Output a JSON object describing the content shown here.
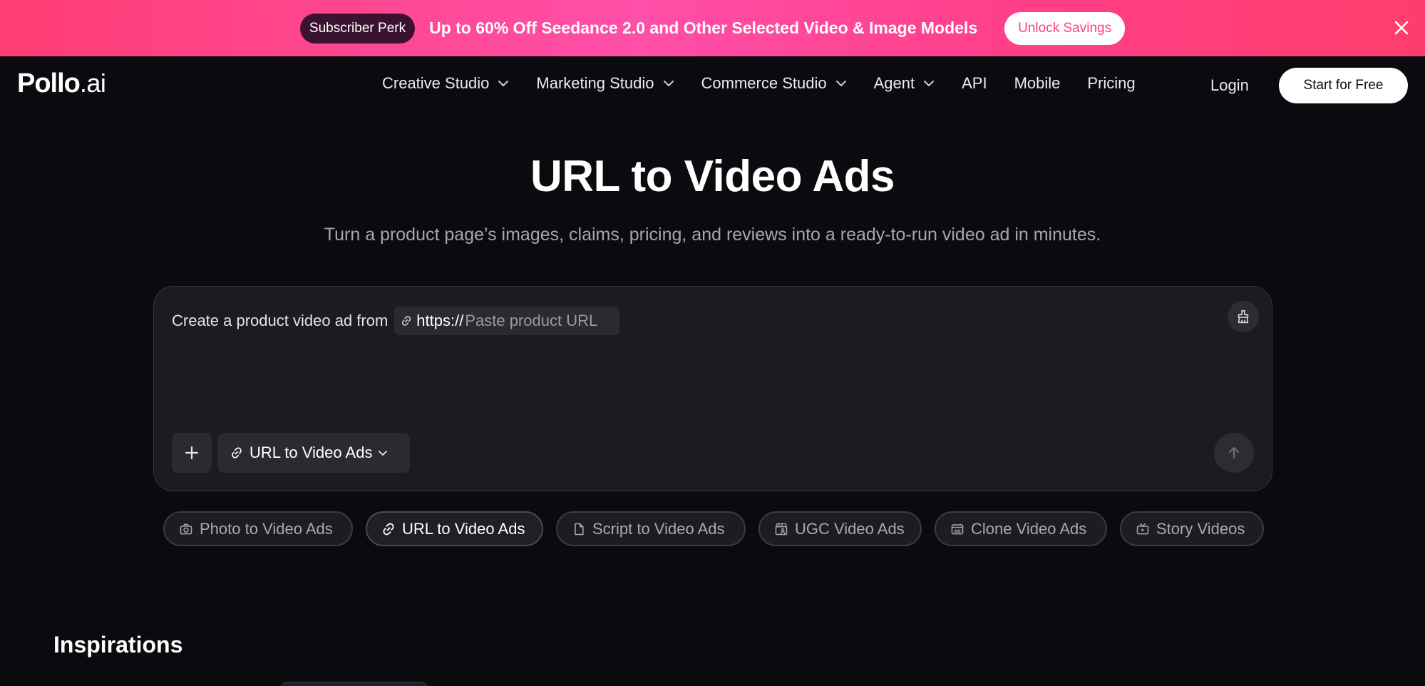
{
  "promo": {
    "badge": "Subscriber Perk",
    "text": "Up to 60% Off Seedance 2.0 and Other Selected Video & Image Models",
    "cta": "Unlock Savings"
  },
  "nav": {
    "logo_main": "Pollo",
    "logo_sub": ".ai",
    "items": [
      {
        "label": "Creative Studio",
        "dropdown": true
      },
      {
        "label": "Marketing Studio",
        "dropdown": true
      },
      {
        "label": "Commerce Studio",
        "dropdown": true
      },
      {
        "label": "Agent",
        "dropdown": true
      },
      {
        "label": "API",
        "dropdown": false
      },
      {
        "label": "Mobile",
        "dropdown": false
      },
      {
        "label": "Pricing",
        "dropdown": false
      }
    ],
    "login": "Login",
    "cta": "Start for Free"
  },
  "hero": {
    "title": "URL to Video Ads",
    "subtitle": "Turn a product page’s images, claims, pricing, and reviews into a ready-to-run video ad in minutes."
  },
  "composer": {
    "prompt_prefix": "Create a product video ad from",
    "url_prefix": "https://",
    "url_placeholder": "Paste product URL",
    "url_value": "",
    "mode_label": "URL to Video Ads"
  },
  "modes": [
    {
      "label": "Photo to Video Ads",
      "icon": "camera-icon",
      "active": false
    },
    {
      "label": "URL to Video Ads",
      "icon": "link-icon",
      "active": true
    },
    {
      "label": "Script to Video Ads",
      "icon": "document-icon",
      "active": false
    },
    {
      "label": "UGC Video Ads",
      "icon": "clapperboard-user-icon",
      "active": false
    },
    {
      "label": "Clone Video Ads",
      "icon": "ad-icon",
      "active": false
    },
    {
      "label": "Story Videos",
      "icon": "tv-play-icon",
      "active": false
    }
  ],
  "inspirations": {
    "title": "Inspirations"
  },
  "colors": {
    "background": "#0b0b0f",
    "promo_start": "#ff3d74",
    "promo_mid": "#ff4fa8",
    "perk_bg": "#3b1330",
    "unlock_text": "#ff3f7f",
    "panel": "#1b1b21"
  }
}
